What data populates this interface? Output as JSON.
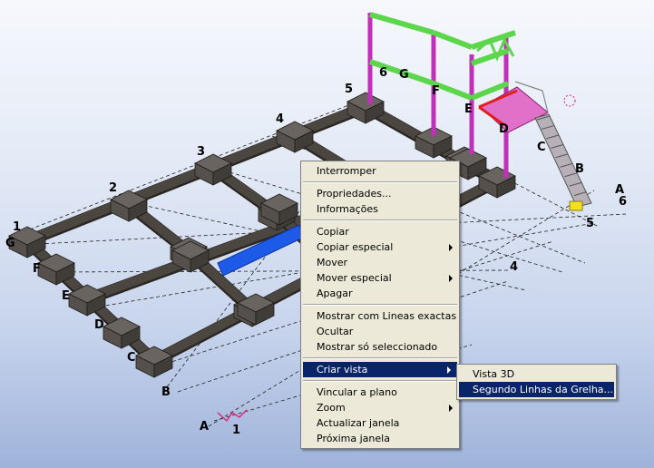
{
  "context_menu": {
    "groups": [
      [
        {
          "label": "Interromper"
        }
      ],
      [
        {
          "label": "Propriedades..."
        },
        {
          "label": "Informações"
        }
      ],
      [
        {
          "label": "Copiar"
        },
        {
          "label": "Copiar especial",
          "submenu": true
        },
        {
          "label": "Mover"
        },
        {
          "label": "Mover especial",
          "submenu": true
        },
        {
          "label": "Apagar"
        }
      ],
      [
        {
          "label": "Mostrar com Lineas exactas"
        },
        {
          "label": "Ocultar"
        },
        {
          "label": "Mostrar só seleccionado"
        }
      ],
      [
        {
          "label": "Criar vista",
          "submenu": true,
          "highlighted": true
        }
      ],
      [
        {
          "label": "Vincular a plano"
        },
        {
          "label": "Zoom",
          "submenu": true
        },
        {
          "label": "Actualizar janela"
        },
        {
          "label": "Próxima janela"
        }
      ]
    ]
  },
  "submenu": {
    "items": [
      {
        "label": "Vista 3D"
      },
      {
        "label": "Segundo Linhas da Grelha...",
        "highlighted": true
      }
    ]
  },
  "grid_labels": {
    "near_numbers": [
      "1",
      "2",
      "3",
      "4",
      "5",
      "6"
    ],
    "left_letters": [
      "G",
      "F",
      "E",
      "D",
      "C",
      "B",
      "A"
    ],
    "far_letters": [
      "G",
      "F",
      "E",
      "D",
      "C",
      "B",
      "A"
    ],
    "right_numbers": [
      "6",
      "5",
      "4",
      "1"
    ]
  },
  "colors": {
    "beam": "#4c4641",
    "pad": "#55504b",
    "column": "#c030b8",
    "rafter": "#5cd64a",
    "platform_beam": "#e02020",
    "platform_grating": "#e070c8",
    "selected": "#1e5ae8",
    "base_plate": "#f0e020",
    "menu_highlight": "#0a246a"
  }
}
